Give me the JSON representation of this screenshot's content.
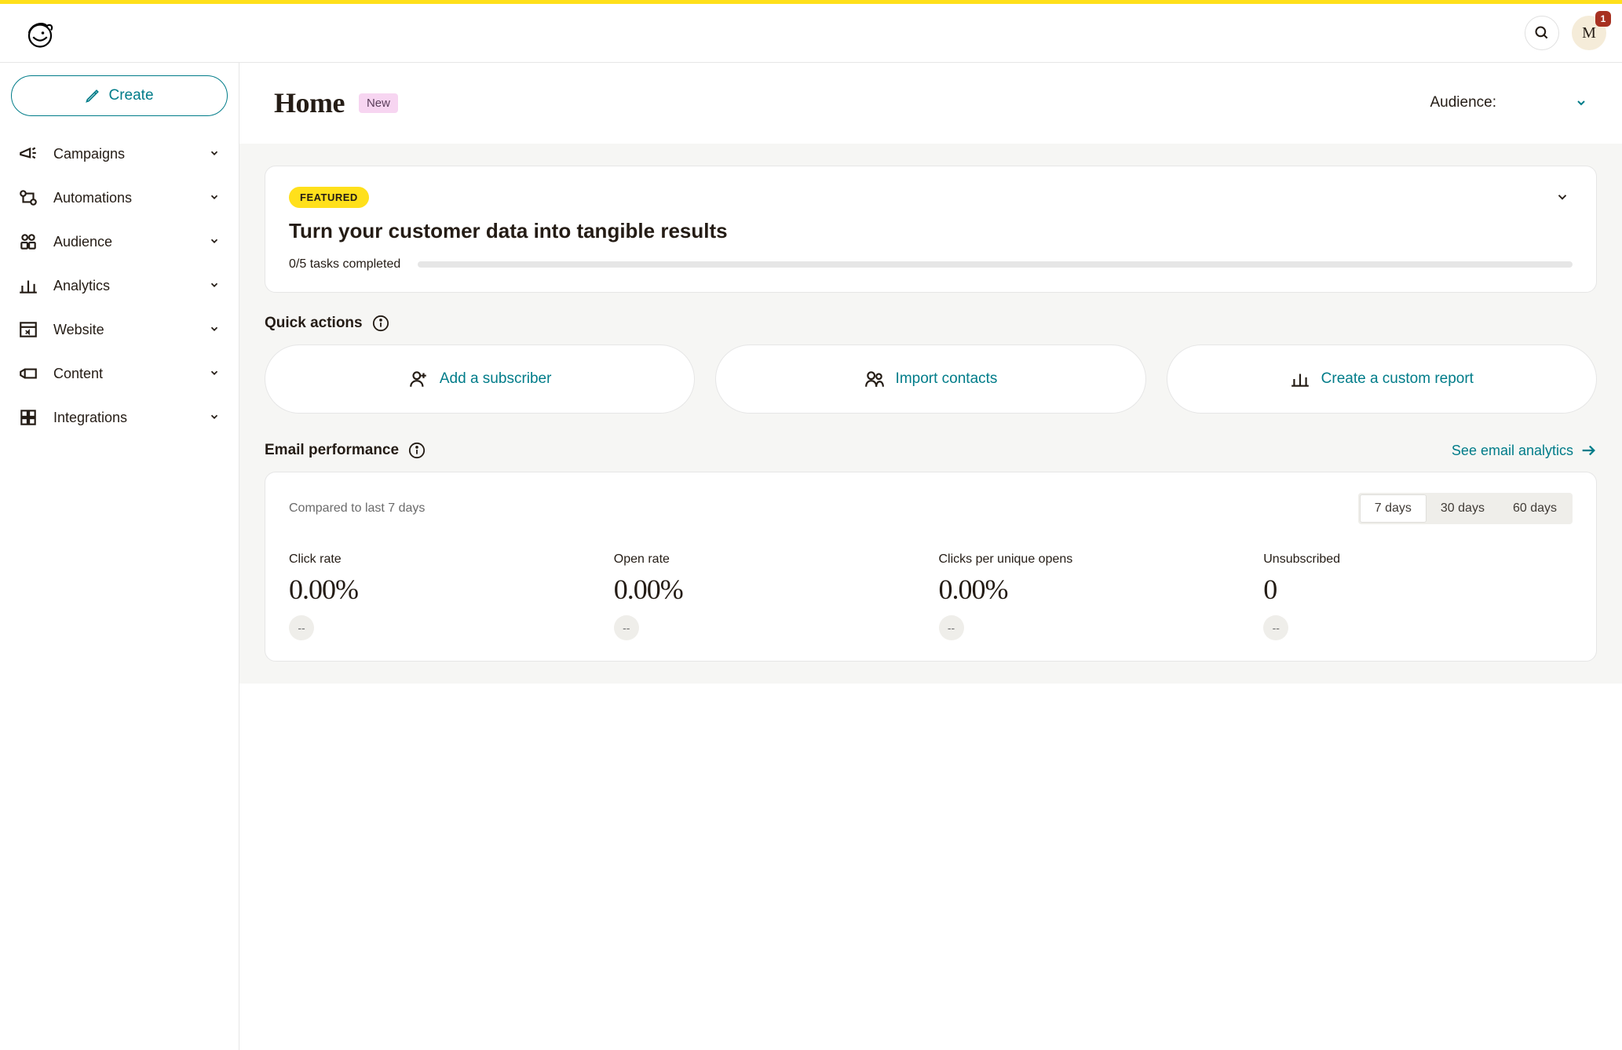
{
  "header": {
    "avatar_initial": "M",
    "notification_count": "1"
  },
  "sidebar": {
    "create_label": "Create",
    "items": [
      {
        "label": "Campaigns"
      },
      {
        "label": "Automations"
      },
      {
        "label": "Audience"
      },
      {
        "label": "Analytics"
      },
      {
        "label": "Website"
      },
      {
        "label": "Content"
      },
      {
        "label": "Integrations"
      }
    ]
  },
  "page": {
    "title": "Home",
    "new_badge": "New",
    "audience_label": "Audience:"
  },
  "featured": {
    "badge": "FEATURED",
    "title": "Turn your customer data into tangible results",
    "progress_text": "0/5 tasks completed"
  },
  "quick_actions_title": "Quick actions",
  "quick_actions": [
    {
      "label": "Add a subscriber"
    },
    {
      "label": "Import contacts"
    },
    {
      "label": "Create a custom report"
    }
  ],
  "email_perf": {
    "title": "Email performance",
    "see_link": "See email analytics",
    "compared": "Compared to last 7 days",
    "ranges": [
      "7 days",
      "30 days",
      "60 days"
    ],
    "active_range_index": 0,
    "stats": [
      {
        "label": "Click rate",
        "value": "0.00%",
        "delta": "--"
      },
      {
        "label": "Open rate",
        "value": "0.00%",
        "delta": "--"
      },
      {
        "label": "Clicks per unique opens",
        "value": "0.00%",
        "delta": "--"
      },
      {
        "label": "Unsubscribed",
        "value": "0",
        "delta": "--"
      }
    ]
  }
}
